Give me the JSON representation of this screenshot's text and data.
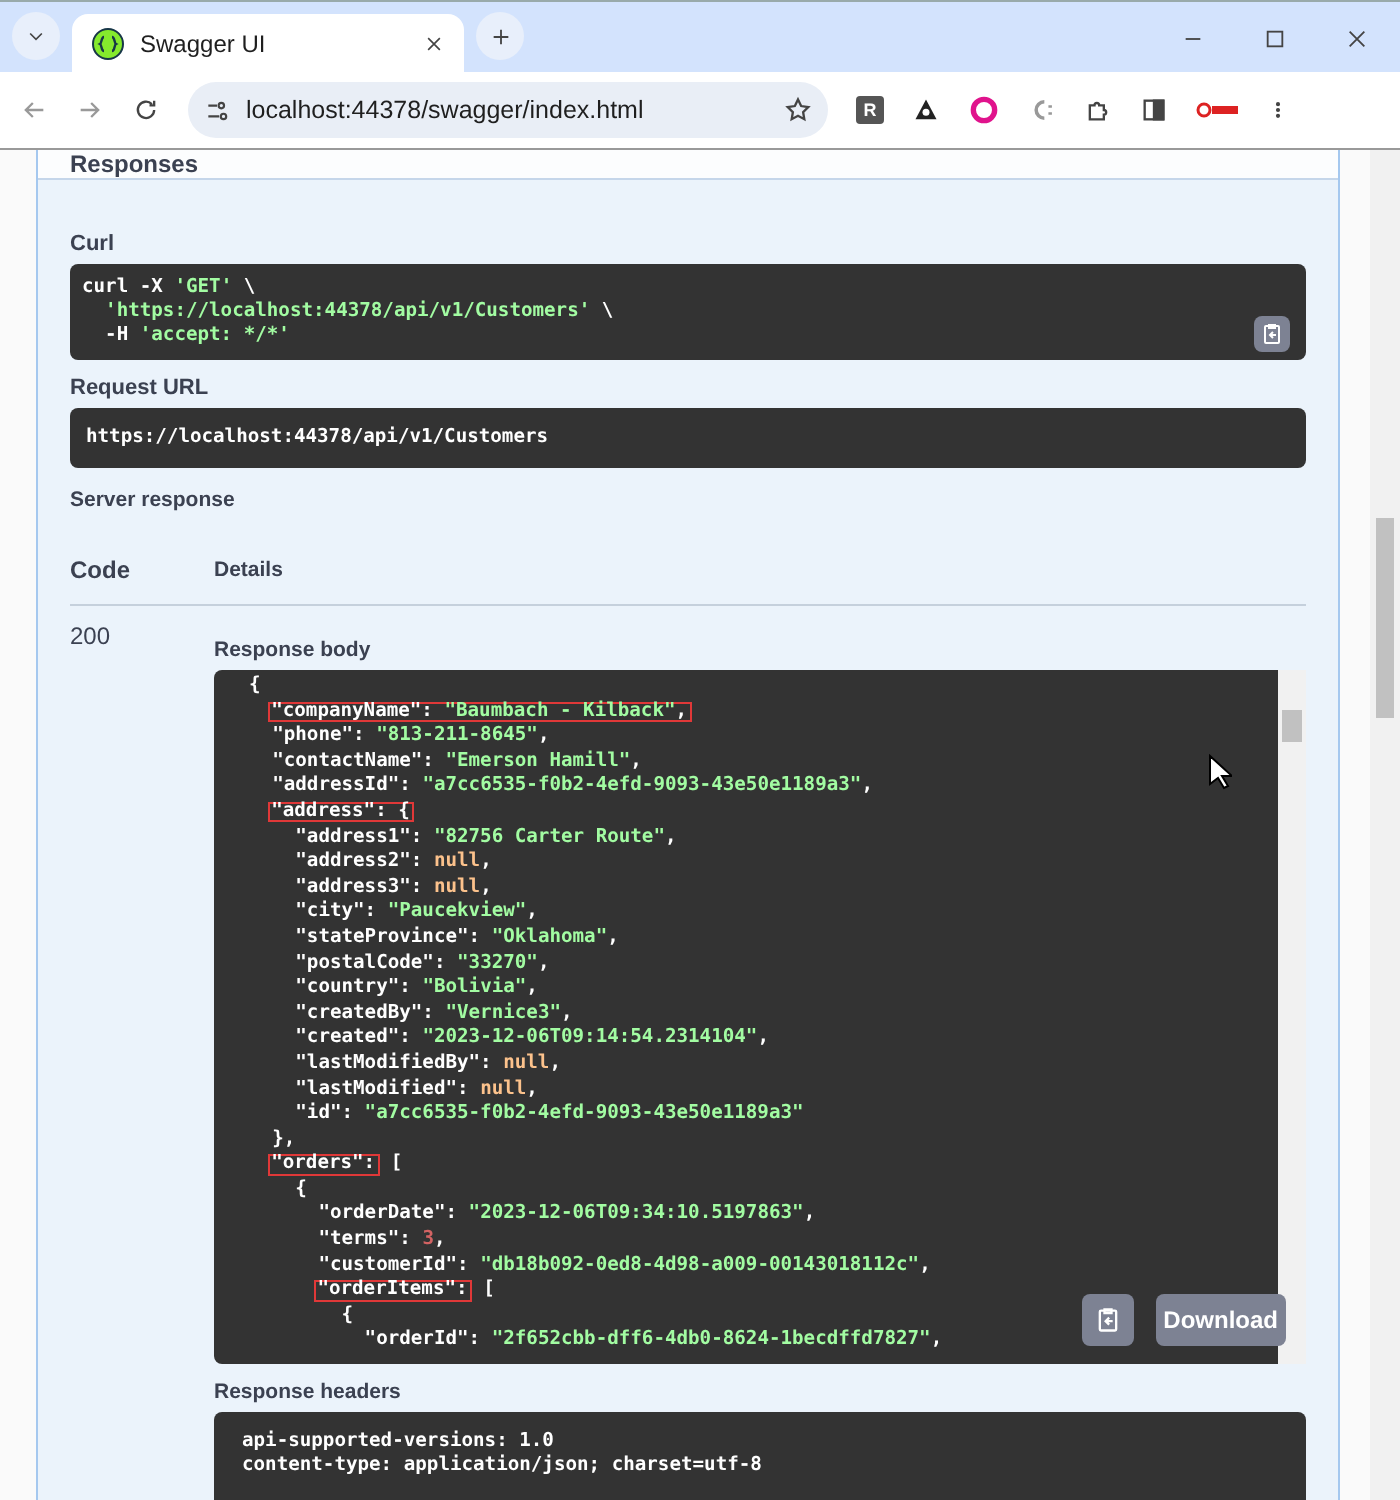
{
  "browser": {
    "tab_title": "Swagger UI",
    "url": "localhost:44378/swagger/index.html",
    "extension_letter": "R"
  },
  "section_title": "Responses",
  "curl": {
    "label": "Curl",
    "lines": [
      {
        "tokens": [
          {
            "kind": "plain",
            "text": "curl -X "
          },
          {
            "kind": "string",
            "text": "'GET'"
          },
          {
            "kind": "plain",
            "text": " \\"
          }
        ],
        "children": [
          {
            "tokens": [
              {
                "kind": "string",
                "text": "'https://localhost:44378/api/v1/Customers'"
              },
              {
                "kind": "plain",
                "text": " \\"
              }
            ]
          },
          {
            "tokens": [
              {
                "kind": "plain",
                "text": "-H "
              },
              {
                "kind": "string",
                "text": "'accept: */*'"
              }
            ]
          }
        ]
      }
    ]
  },
  "request_url": {
    "label": "Request URL",
    "value": "https://localhost:44378/api/v1/Customers"
  },
  "server_response_label": "Server response",
  "columns": [
    "Code",
    "Details"
  ],
  "response": {
    "code": "200",
    "body_label": "Response body",
    "download_label": "Download",
    "body_lines": [
      {
        "tokens": [
          {
            "kind": "plain",
            "text": "{"
          }
        ],
        "children": [
          {
            "tokens": [
              {
                "kind": "boxed",
                "tokens": [
                  {
                    "kind": "key",
                    "text": "\"companyName\": "
                  },
                  {
                    "kind": "string",
                    "text": "\"Baumbach - Kilback\""
                  },
                  {
                    "kind": "plain",
                    "text": ","
                  }
                ]
              }
            ]
          },
          {
            "tokens": [
              {
                "kind": "key",
                "text": "\"phone\": "
              },
              {
                "kind": "string",
                "text": "\"813-211-8645\""
              },
              {
                "kind": "plain",
                "text": ","
              }
            ]
          },
          {
            "tokens": [
              {
                "kind": "key",
                "text": "\"contactName\": "
              },
              {
                "kind": "string",
                "text": "\"Emerson Hamill\""
              },
              {
                "kind": "plain",
                "text": ","
              }
            ]
          },
          {
            "tokens": [
              {
                "kind": "key",
                "text": "\"addressId\": "
              },
              {
                "kind": "string",
                "text": "\"a7cc6535-f0b2-4efd-9093-43e50e1189a3\""
              },
              {
                "kind": "plain",
                "text": ","
              }
            ]
          },
          {
            "tokens": [
              {
                "kind": "boxed",
                "tokens": [
                  {
                    "kind": "key",
                    "text": "\"address\": {"
                  }
                ]
              }
            ],
            "children": [
              {
                "tokens": [
                  {
                    "kind": "key",
                    "text": "\"address1\": "
                  },
                  {
                    "kind": "string",
                    "text": "\"82756 Carter Route\""
                  },
                  {
                    "kind": "plain",
                    "text": ","
                  }
                ]
              },
              {
                "tokens": [
                  {
                    "kind": "key",
                    "text": "\"address2\": "
                  },
                  {
                    "kind": "null",
                    "text": "null"
                  },
                  {
                    "kind": "plain",
                    "text": ","
                  }
                ]
              },
              {
                "tokens": [
                  {
                    "kind": "key",
                    "text": "\"address3\": "
                  },
                  {
                    "kind": "null",
                    "text": "null"
                  },
                  {
                    "kind": "plain",
                    "text": ","
                  }
                ]
              },
              {
                "tokens": [
                  {
                    "kind": "key",
                    "text": "\"city\": "
                  },
                  {
                    "kind": "string",
                    "text": "\"Paucekview\""
                  },
                  {
                    "kind": "plain",
                    "text": ","
                  }
                ]
              },
              {
                "tokens": [
                  {
                    "kind": "key",
                    "text": "\"stateProvince\": "
                  },
                  {
                    "kind": "string",
                    "text": "\"Oklahoma\""
                  },
                  {
                    "kind": "plain",
                    "text": ","
                  }
                ]
              },
              {
                "tokens": [
                  {
                    "kind": "key",
                    "text": "\"postalCode\": "
                  },
                  {
                    "kind": "string",
                    "text": "\"33270\""
                  },
                  {
                    "kind": "plain",
                    "text": ","
                  }
                ]
              },
              {
                "tokens": [
                  {
                    "kind": "key",
                    "text": "\"country\": "
                  },
                  {
                    "kind": "string",
                    "text": "\"Bolivia\""
                  },
                  {
                    "kind": "plain",
                    "text": ","
                  }
                ]
              },
              {
                "tokens": [
                  {
                    "kind": "key",
                    "text": "\"createdBy\": "
                  },
                  {
                    "kind": "string",
                    "text": "\"Vernice3\""
                  },
                  {
                    "kind": "plain",
                    "text": ","
                  }
                ]
              },
              {
                "tokens": [
                  {
                    "kind": "key",
                    "text": "\"created\": "
                  },
                  {
                    "kind": "string",
                    "text": "\"2023-12-06T09:14:54.2314104\""
                  },
                  {
                    "kind": "plain",
                    "text": ","
                  }
                ]
              },
              {
                "tokens": [
                  {
                    "kind": "key",
                    "text": "\"lastModifiedBy\": "
                  },
                  {
                    "kind": "null",
                    "text": "null"
                  },
                  {
                    "kind": "plain",
                    "text": ","
                  }
                ]
              },
              {
                "tokens": [
                  {
                    "kind": "key",
                    "text": "\"lastModified\": "
                  },
                  {
                    "kind": "null",
                    "text": "null"
                  },
                  {
                    "kind": "plain",
                    "text": ","
                  }
                ]
              },
              {
                "tokens": [
                  {
                    "kind": "key",
                    "text": "\"id\": "
                  },
                  {
                    "kind": "string",
                    "text": "\"a7cc6535-f0b2-4efd-9093-43e50e1189a3\""
                  }
                ]
              }
            ]
          },
          {
            "tokens": [
              {
                "kind": "plain",
                "text": "},"
              }
            ]
          },
          {
            "tokens": [
              {
                "kind": "boxed",
                "tokens": [
                  {
                    "kind": "key",
                    "text": "\"orders\":"
                  }
                ]
              },
              {
                "kind": "plain",
                "text": " ["
              }
            ],
            "children": [
              {
                "tokens": [
                  {
                    "kind": "plain",
                    "text": "{"
                  }
                ],
                "children": [
                  {
                    "tokens": [
                      {
                        "kind": "key",
                        "text": "\"orderDate\": "
                      },
                      {
                        "kind": "string",
                        "text": "\"2023-12-06T09:34:10.5197863\""
                      },
                      {
                        "kind": "plain",
                        "text": ","
                      }
                    ]
                  },
                  {
                    "tokens": [
                      {
                        "kind": "key",
                        "text": "\"terms\": "
                      },
                      {
                        "kind": "number",
                        "text": "3"
                      },
                      {
                        "kind": "plain",
                        "text": ","
                      }
                    ]
                  },
                  {
                    "tokens": [
                      {
                        "kind": "key",
                        "text": "\"customerId\": "
                      },
                      {
                        "kind": "string",
                        "text": "\"db18b092-0ed8-4d98-a009-00143018112c\""
                      },
                      {
                        "kind": "plain",
                        "text": ","
                      }
                    ]
                  },
                  {
                    "tokens": [
                      {
                        "kind": "boxed",
                        "tokens": [
                          {
                            "kind": "key",
                            "text": "\"orderItems\":"
                          }
                        ]
                      },
                      {
                        "kind": "plain",
                        "text": " ["
                      }
                    ],
                    "children": [
                      {
                        "tokens": [
                          {
                            "kind": "plain",
                            "text": "{"
                          }
                        ],
                        "children": [
                          {
                            "tokens": [
                              {
                                "kind": "key",
                                "text": "\"orderId\": "
                              },
                              {
                                "kind": "string",
                                "text": "\"2f652cbb-dff6-4db0-8624-1becdffd7827\""
                              },
                              {
                                "kind": "plain",
                                "text": ","
                              }
                            ]
                          }
                        ]
                      }
                    ]
                  }
                ]
              }
            ]
          }
        ]
      }
    ]
  },
  "response_headers": {
    "label": "Response headers",
    "lines": [
      "api-supported-versions: 1.0",
      "content-type: application/json; charset=utf-8"
    ]
  }
}
